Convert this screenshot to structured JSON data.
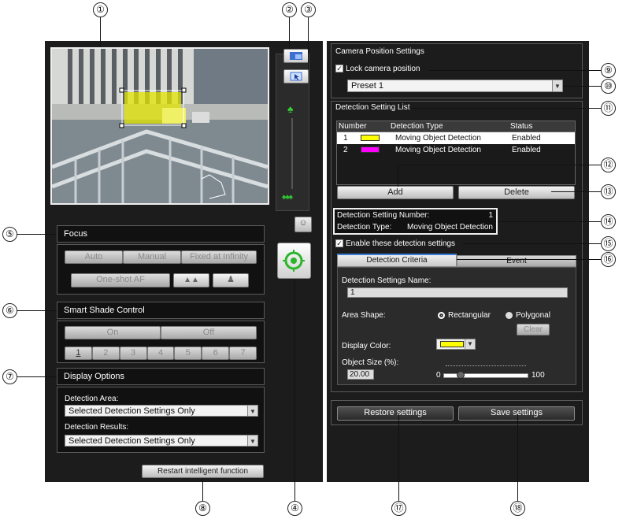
{
  "callouts": [
    "①",
    "②",
    "③",
    "④",
    "⑤",
    "⑥",
    "⑦",
    "⑧",
    "⑨",
    "⑩",
    "⑪",
    "⑫",
    "⑬",
    "⑭",
    "⑮",
    "⑯",
    "⑰",
    "⑱"
  ],
  "focus": {
    "title": "Focus",
    "auto": "Auto",
    "manual": "Manual",
    "infinity": "Fixed at Infinity",
    "oneshot": "One-shot AF"
  },
  "smart_shade": {
    "title": "Smart Shade Control",
    "on": "On",
    "off": "Off",
    "levels": [
      "1",
      "2",
      "3",
      "4",
      "5",
      "6",
      "7"
    ]
  },
  "display_options": {
    "title": "Display Options",
    "area_label": "Detection Area:",
    "area_value": "Selected Detection Settings Only",
    "results_label": "Detection Results:",
    "results_value": "Selected Detection Settings Only"
  },
  "restart_label": "Restart intelligent function",
  "camera_position": {
    "title": "Camera Position Settings",
    "lock_label": "Lock camera position",
    "lock_checked": true,
    "preset_value": "Preset 1"
  },
  "detection_list": {
    "title": "Detection Setting List",
    "columns": [
      "Number",
      "Detection Type",
      "Status"
    ],
    "rows": [
      {
        "number": "1",
        "color": "#ffff00",
        "type": "Moving Object Detection",
        "status": "Enabled"
      },
      {
        "number": "2",
        "color": "#ff00ff",
        "type": "Moving Object Detection",
        "status": "Enabled"
      }
    ],
    "add": "Add",
    "delete": "Delete"
  },
  "info": {
    "number_label": "Detection Setting Number:",
    "number_value": "1",
    "type_label": "Detection Type:",
    "type_value": "Moving Object Detection"
  },
  "enable_label": "Enable these detection settings",
  "tabs": [
    "Detection Criteria",
    "Event"
  ],
  "criteria": {
    "name_label": "Detection Settings Name:",
    "name_value": "1",
    "shape_label": "Area Shape:",
    "rect": "Rectangular",
    "poly": "Polygonal",
    "clear": "Clear",
    "color_label": "Display Color:",
    "display_color": "#ffff00",
    "size_label": "Object Size (%):",
    "size_value": "20.00",
    "slider_min": "0",
    "slider_max": "100",
    "slider_fraction": 0.2
  },
  "restore_label": "Restore settings",
  "save_label": "Save settings"
}
